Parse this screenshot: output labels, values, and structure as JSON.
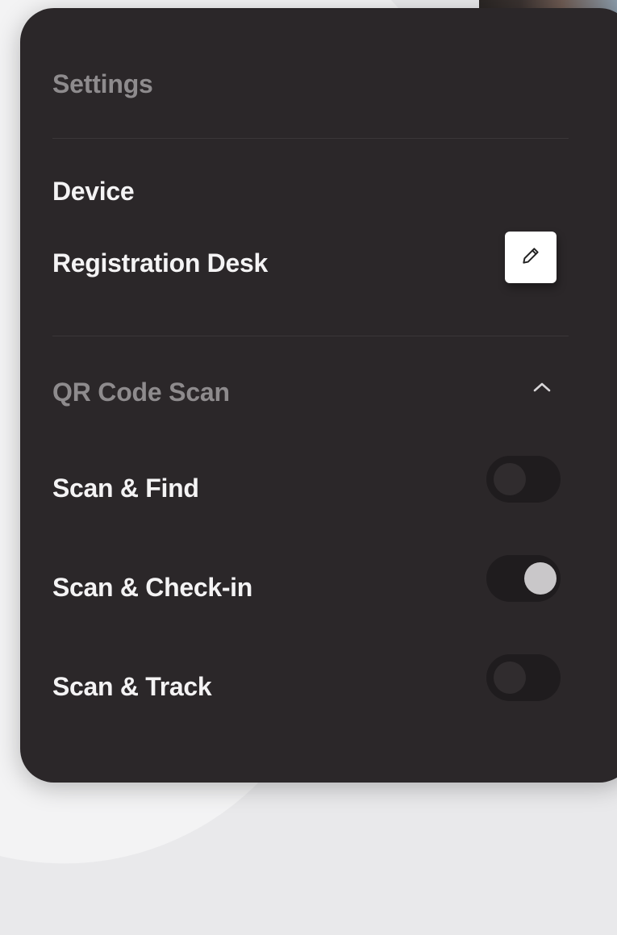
{
  "settings": {
    "title": "Settings"
  },
  "device": {
    "heading": "Device",
    "name": "Registration Desk",
    "edit_icon": "pencil-icon"
  },
  "qr_scan": {
    "title": "QR Code Scan",
    "collapse_icon": "chevron-up-icon",
    "expanded": true,
    "options": [
      {
        "label": "Scan & Find",
        "enabled": false
      },
      {
        "label": "Scan & Check-in",
        "enabled": true
      },
      {
        "label": "Scan & Track",
        "enabled": false
      }
    ]
  },
  "colors": {
    "panel": "#2b2729",
    "text_primary": "#f4f3f4",
    "text_muted": "#8e8b8d",
    "toggle_track": "#1f1c1e",
    "toggle_knob_on": "#c9c7c9"
  }
}
